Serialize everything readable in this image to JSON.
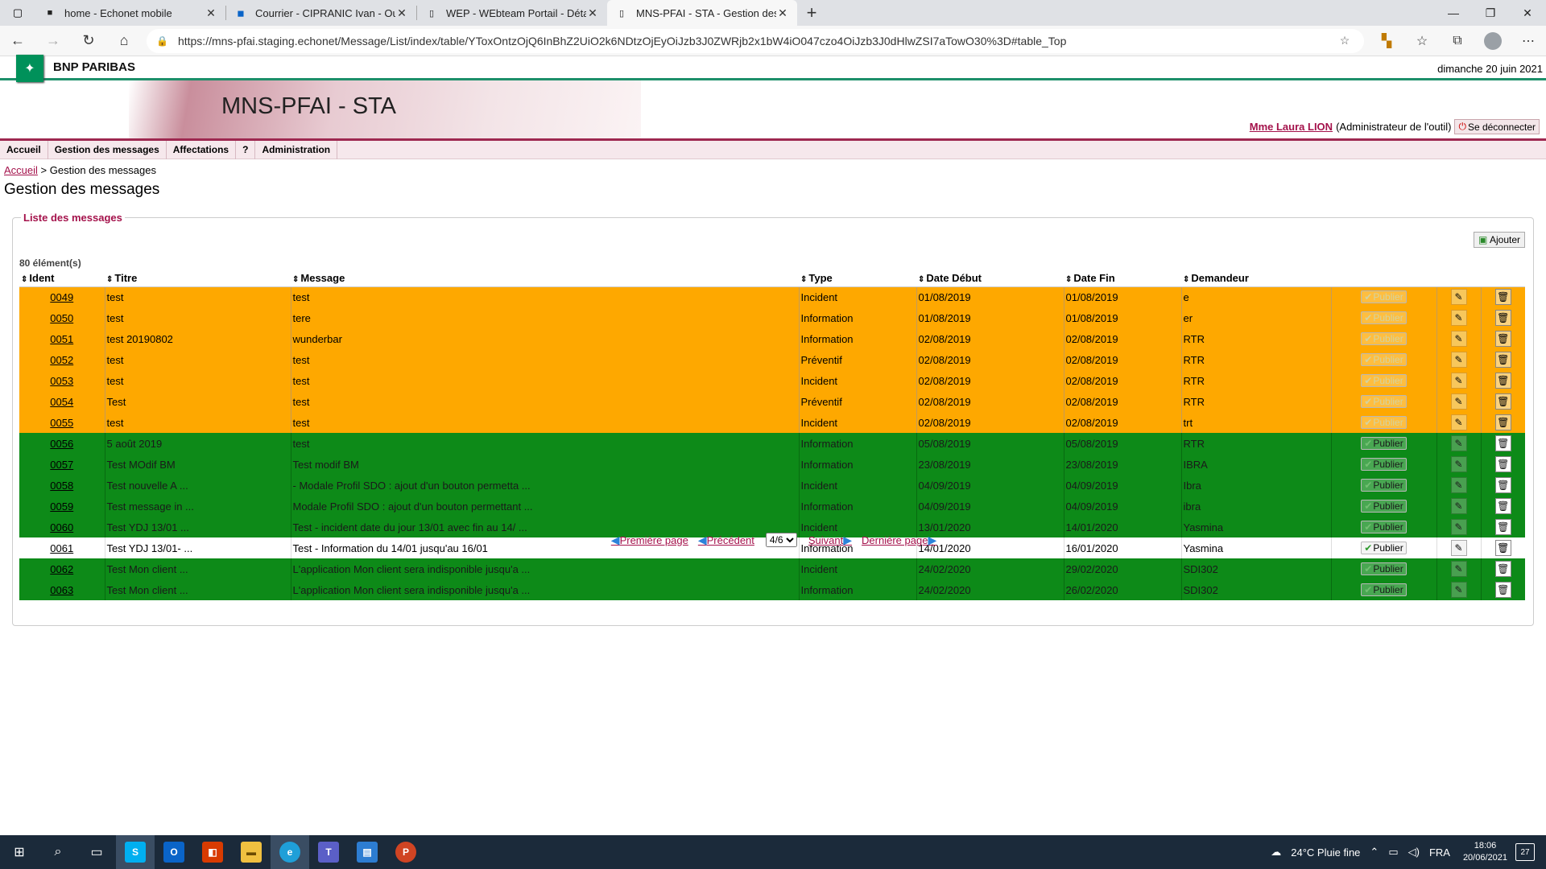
{
  "browser": {
    "tabs": [
      {
        "title": "home - Echonet mobile",
        "active": false
      },
      {
        "title": "Courrier - CIPRANIC Ivan - Outlo",
        "active": false
      },
      {
        "title": "WEP - WEbteam Portail - Détail",
        "active": false
      },
      {
        "title": "MNS-PFAI - STA - Gestion des m",
        "active": true
      }
    ],
    "url": "https://mns-pfai.staging.echonet/Message/List/index/table/YToxOntzOjQ6InBhZ2UiO2k6NDtzOjEyOiJzb3J0ZWRjb2x1bW4iO047czo4OiJzb3J0dHlwZSI7aTowO30%3D#table_Top"
  },
  "header": {
    "brand": "BNP PARIBAS",
    "date": "dimanche 20 juin 2021",
    "app_title": "MNS-PFAI - STA",
    "user_name": "Mme Laura LION",
    "user_role": "(Administrateur de l'outil)",
    "logout": "Se déconnecter"
  },
  "menu": [
    "Accueil",
    "Gestion des messages",
    "Affectations",
    "?",
    "Administration"
  ],
  "breadcrumb": {
    "home": "Accueil",
    "sep": ">",
    "current": "Gestion des messages"
  },
  "page_title": "Gestion des messages",
  "list": {
    "legend": "Liste des messages",
    "add_label": "Ajouter",
    "count": "80 élément(s)",
    "columns": [
      "Ident",
      "Titre",
      "Message",
      "Type",
      "Date Début",
      "Date Fin",
      "Demandeur"
    ],
    "publish_label": "Publier",
    "rows": [
      {
        "id": "0049",
        "title": "test",
        "message": "test",
        "type": "Incident",
        "start": "01/08/2019",
        "end": "01/08/2019",
        "requester": "e",
        "status": "orange"
      },
      {
        "id": "0050",
        "title": "test",
        "message": "tere",
        "type": "Information",
        "start": "01/08/2019",
        "end": "01/08/2019",
        "requester": "er",
        "status": "orange"
      },
      {
        "id": "0051",
        "title": "test 20190802",
        "message": "wunderbar",
        "type": "Information",
        "start": "02/08/2019",
        "end": "02/08/2019",
        "requester": "RTR",
        "status": "orange"
      },
      {
        "id": "0052",
        "title": "test",
        "message": "test",
        "type": "Préventif",
        "start": "02/08/2019",
        "end": "02/08/2019",
        "requester": "RTR",
        "status": "orange"
      },
      {
        "id": "0053",
        "title": "test",
        "message": "test",
        "type": "Incident",
        "start": "02/08/2019",
        "end": "02/08/2019",
        "requester": "RTR",
        "status": "orange"
      },
      {
        "id": "0054",
        "title": "Test",
        "message": "test",
        "type": "Préventif",
        "start": "02/08/2019",
        "end": "02/08/2019",
        "requester": "RTR",
        "status": "orange"
      },
      {
        "id": "0055",
        "title": "test",
        "message": "test",
        "type": "Incident",
        "start": "02/08/2019",
        "end": "02/08/2019",
        "requester": "trt",
        "status": "orange"
      },
      {
        "id": "0056",
        "title": "5 août 2019",
        "message": "test",
        "type": "Information",
        "start": "05/08/2019",
        "end": "05/08/2019",
        "requester": "RTR",
        "status": "green"
      },
      {
        "id": "0057",
        "title": "Test MOdif BM",
        "message": "Test modif BM",
        "type": "Information",
        "start": "23/08/2019",
        "end": "23/08/2019",
        "requester": "IBRA",
        "status": "green"
      },
      {
        "id": "0058",
        "title": "Test nouvelle A ...",
        "message": "- Modale Profil SDO : ajout d'un bouton permetta ...",
        "type": "Incident",
        "start": "04/09/2019",
        "end": "04/09/2019",
        "requester": "Ibra",
        "status": "green"
      },
      {
        "id": "0059",
        "title": "Test message in ...",
        "message": "Modale Profil SDO : ajout d'un bouton permettant ...",
        "type": "Information",
        "start": "04/09/2019",
        "end": "04/09/2019",
        "requester": "ibra",
        "status": "green"
      },
      {
        "id": "0060",
        "title": "Test YDJ 13/01 ...",
        "message": "Test - incident date du jour 13/01 avec fin au 14/ ...",
        "type": "Incident",
        "start": "13/01/2020",
        "end": "14/01/2020",
        "requester": "Yasmina",
        "status": "green"
      },
      {
        "id": "0061",
        "title": "Test YDJ 13/01- ...",
        "message": "Test - Information du 14/01 jusqu'au 16/01",
        "type": "Information",
        "start": "14/01/2020",
        "end": "16/01/2020",
        "requester": "Yasmina",
        "status": "white"
      },
      {
        "id": "0062",
        "title": "Test Mon client ...",
        "message": "L'application Mon client sera indisponible jusqu'a ...",
        "type": "Incident",
        "start": "24/02/2020",
        "end": "29/02/2020",
        "requester": "SDI302",
        "status": "green"
      },
      {
        "id": "0063",
        "title": "Test Mon client ...",
        "message": "L'application Mon client sera indisponible jusqu'a ...",
        "type": "Information",
        "start": "24/02/2020",
        "end": "26/02/2020",
        "requester": "SDI302",
        "status": "green"
      }
    ]
  },
  "pager": {
    "first": "Première page",
    "prev": "Précédent",
    "page_value": "4/6",
    "next": "Suivant",
    "last": "Dernière page"
  },
  "taskbar": {
    "weather": "24°C Pluie fine",
    "lang": "FRA",
    "time": "18:06",
    "date": "20/06/2021",
    "notifications": "27"
  },
  "colors": {
    "orange_row": "#fea800",
    "green_row": "#0d8a18",
    "accent": "#a4124b",
    "bnp_green": "#00915a"
  }
}
